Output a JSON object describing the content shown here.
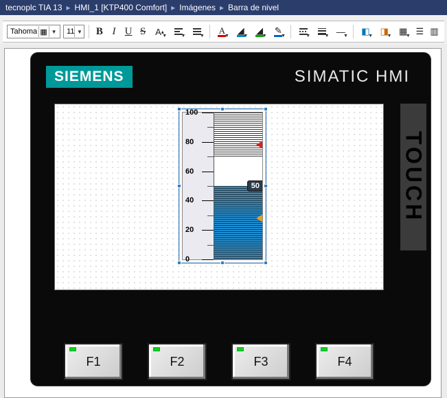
{
  "breadcrumb": [
    "tecnoplc TIA 13",
    "HMI_1 [KTP400 Comfort]",
    "Imágenes",
    "Barra de nivel"
  ],
  "toolbar": {
    "font_name": "Tahoma",
    "font_size": "11"
  },
  "device": {
    "brand": "SIEMENS",
    "model": "SIMATIC HMI",
    "strip": "TOUCH",
    "fkeys": [
      "F1",
      "F2",
      "F3",
      "F4"
    ]
  },
  "chart_data": {
    "type": "bar",
    "title": "Barra de nivel",
    "orientation": "vertical",
    "scale": {
      "min": 0,
      "max": 100,
      "major_ticks": [
        0,
        20,
        40,
        60,
        80,
        100
      ],
      "minor_step": 10
    },
    "value": 50,
    "limits": {
      "high": 78,
      "low": 28
    },
    "fill_color": "#1d8fd6",
    "hatch_zones": [
      {
        "from": 70,
        "to": 100
      },
      {
        "from": 0,
        "to": 50
      }
    ],
    "tick_labels": [
      "100",
      "80",
      "60",
      "40",
      "20",
      "0"
    ]
  }
}
